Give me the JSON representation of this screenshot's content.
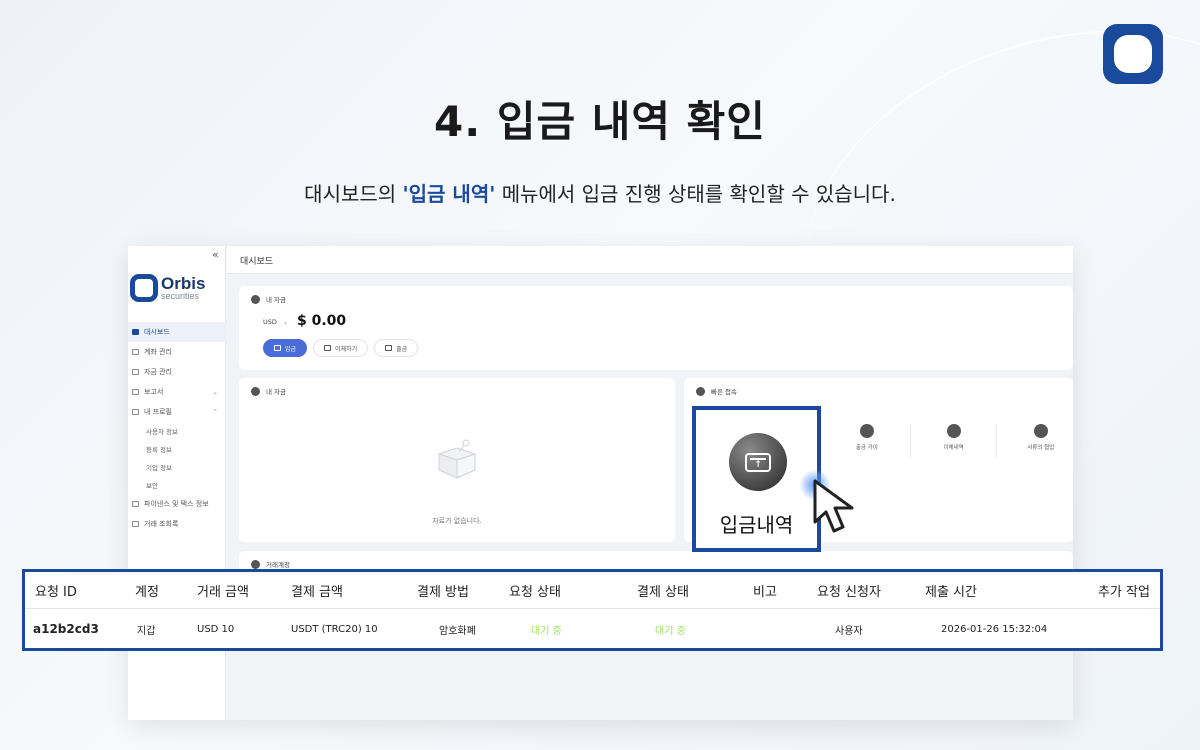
{
  "slide": {
    "title": "4. 입금 내역 확인",
    "subtitle_before": "대시보드의 ",
    "subtitle_highlight": "'입금 내역'",
    "subtitle_after": " 메뉴에서 입금 진행 상태를 확인할 수 있습니다.",
    "accent_color": "#1a4a9c"
  },
  "app": {
    "collapse_icon": "«",
    "logo": {
      "name": "Orbis",
      "tagline": "securities"
    },
    "nav": [
      {
        "label": "대시보드",
        "active": true
      },
      {
        "label": "계좌 관리"
      },
      {
        "label": "자금 관리"
      },
      {
        "label": "보고서",
        "chevron": "⌄"
      },
      {
        "label": "내 프로필",
        "chevron": "⌃"
      }
    ],
    "nav_sub": [
      "사용자 정보",
      "등록 정보",
      "기업 정보",
      "보안"
    ],
    "nav_bottom": [
      "파이낸스 및 택스 정보",
      "거래 조회록"
    ],
    "page_title": "대시보드",
    "balance": {
      "title": "내 자금",
      "currency": "USD",
      "currency_caret": "⌄",
      "amount": "$ 0.00",
      "buttons": [
        "입금",
        "이체하기",
        "출금"
      ]
    },
    "assets": {
      "title": "내 자금",
      "empty_text": "자료가 없습니다."
    },
    "quick": {
      "title": "빠른 접속",
      "items": [
        "출금 가이",
        "이체내역",
        "서류의 협업"
      ]
    },
    "history": {
      "title": "거래계정"
    }
  },
  "highlight": {
    "label": "입금내역",
    "icon": "deposit-card-icon"
  },
  "table": {
    "headers": [
      "요청 ID",
      "계정",
      "거래 금액",
      "결제 금액",
      "결제 방법",
      "요청 상태",
      "결제 상태",
      "비고",
      "요청 신청자",
      "제출 시간",
      "추가 작업"
    ],
    "row": {
      "id": "a12b2cd3",
      "account": "지갑",
      "trade_amount": "USD 10",
      "pay_amount": "USDT (TRC20) 10",
      "method": "암호화폐",
      "req_status": "대기 중",
      "pay_status": "대기 중",
      "note": "",
      "requester": "사용자",
      "submitted": "2026-01-26 15:32:04",
      "action": ""
    },
    "status_color": "#9ee05a"
  }
}
